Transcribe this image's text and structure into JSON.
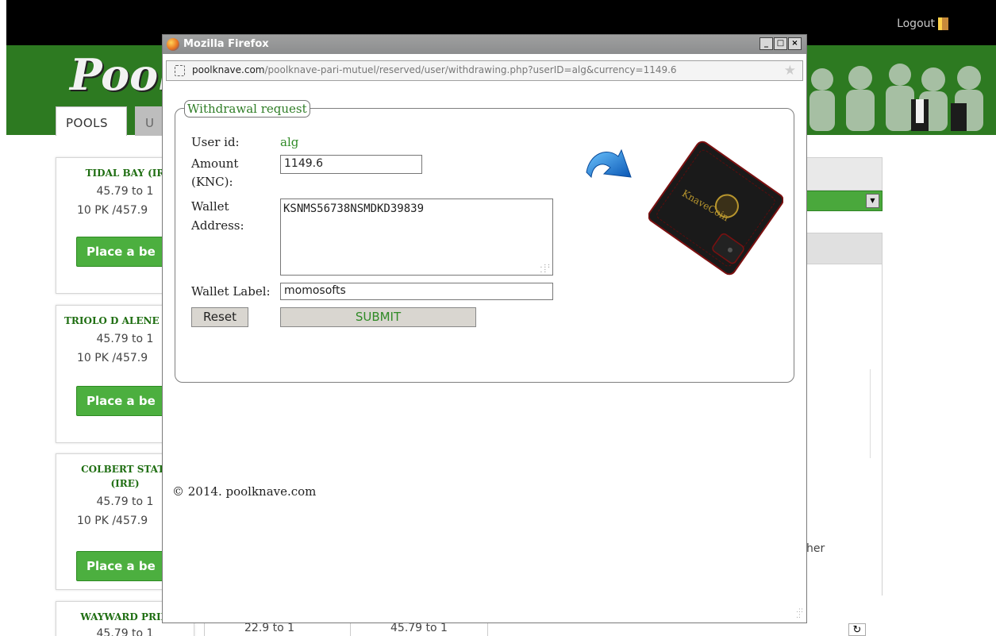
{
  "site": {
    "logout_label": "Logout",
    "logo_text": "Pool",
    "tabs": [
      {
        "label": "POOLS"
      },
      {
        "label": "U"
      }
    ],
    "cards": [
      {
        "title": "TIDAL BAY (IR",
        "odds": "45.79 to 1",
        "pk": "10 PK /457.9",
        "button": "Place a be"
      },
      {
        "title": "TRIOLO D ALENE",
        "odds": "45.79 to 1",
        "pk": "10 PK /457.9",
        "button": "Place a be"
      },
      {
        "title": "COLBERT STATI",
        "title2": "(IRE)",
        "odds": "45.79 to 1",
        "pk": "10 PK /457.9",
        "button": "Place a be"
      },
      {
        "title": "WAYWARD PRIN",
        "odds": "45.79 to 1"
      }
    ],
    "right_snippet": "her",
    "bottom_cells": [
      "22.9 to 1",
      "45.79 to 1"
    ]
  },
  "popup": {
    "window_title": "Mozilla Firefox",
    "url_domain": "poolknave.com",
    "url_path": "/poolknave-pari-mutuel/reserved/user/withdrawing.php?userID=alg&currency=1149.6",
    "form": {
      "legend": "Withdrawal request",
      "user_id_label": "User id:",
      "user_id_value": "alg",
      "amount_label_1": "Amount",
      "amount_label_2": "(KNC):",
      "amount_value": "1149.6",
      "wallet_address_label_1": "Wallet",
      "wallet_address_label_2": "Address:",
      "wallet_address_value": "KSNMS56738NSMDKD39839",
      "wallet_label_label": "Wallet Label:",
      "wallet_label_value": "momosofts",
      "reset_label": "Reset",
      "submit_label": "SUBMIT"
    },
    "wallet_image_text": "KnaveCoin",
    "copyright": "© 2014. poolknave.com"
  },
  "colors": {
    "site_green": "#2d7a21",
    "button_green": "#4caf3f",
    "text_green": "#2f8a26"
  }
}
